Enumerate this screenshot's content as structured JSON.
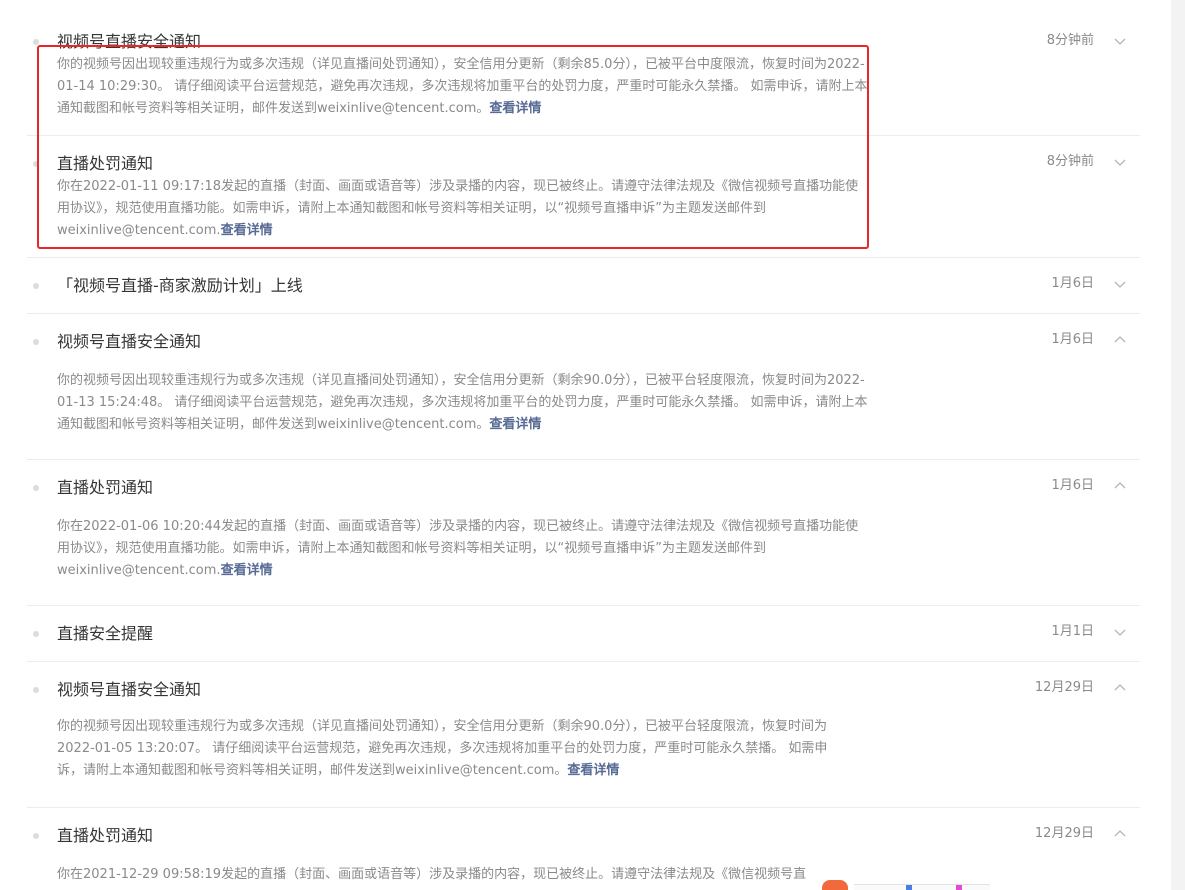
{
  "see_detail_label": "查看详情",
  "notices": [
    {
      "title": "视频号直播安全通知",
      "date": "8分钟前",
      "expanded": true,
      "body": "你的视频号因出现较重违规行为或多次违规（详见直播间处罚通知），安全信用分更新（剩余85.0分），已被平台中度限流，恢复时间为2022-01-14 10:29:30。 请仔细阅读平台运营规范，避免再次违规，多次违规将加重平台的处罚力度，严重时可能永久禁播。 如需申诉，请附上本通知截图和帐号资料等相关证明，邮件发送到weixinlive@tencent.com。"
    },
    {
      "title": "直播处罚通知",
      "date": "8分钟前",
      "expanded": true,
      "body": "你在2022-01-11 09:17:18发起的直播（封面、画面或语音等）涉及录播的内容，现已被终止。请遵守法律法规及《微信视频号直播功能使用协议》，规范使用直播功能。如需申诉，请附上本通知截图和帐号资料等相关证明，以“视频号直播申诉”为主题发送邮件到weixinlive@tencent.com."
    },
    {
      "title": "「视频号直播-商家激励计划」上线",
      "date": "1月6日",
      "expanded": false,
      "body": ""
    },
    {
      "title": "视频号直播安全通知",
      "date": "1月6日",
      "expanded": true,
      "body": "你的视频号因出现较重违规行为或多次违规（详见直播间处罚通知），安全信用分更新（剩余90.0分），已被平台轻度限流，恢复时间为2022-01-13 15:24:48。 请仔细阅读平台运营规范，避免再次违规，多次违规将加重平台的处罚力度，严重时可能永久禁播。 如需申诉，请附上本通知截图和帐号资料等相关证明，邮件发送到weixinlive@tencent.com。"
    },
    {
      "title": "直播处罚通知",
      "date": "1月6日",
      "expanded": true,
      "body": "你在2022-01-06 10:20:44发起的直播（封面、画面或语音等）涉及录播的内容，现已被终止。请遵守法律法规及《微信视频号直播功能使用协议》，规范使用直播功能。如需申诉，请附上本通知截图和帐号资料等相关证明，以“视频号直播申诉”为主题发送邮件到weixinlive@tencent.com."
    },
    {
      "title": "直播安全提醒",
      "date": "1月1日",
      "expanded": false,
      "body": ""
    },
    {
      "title": "视频号直播安全通知",
      "date": "12月29日",
      "expanded": true,
      "body": "你的视频号因出现较重违规行为或多次违规（详见直播间处罚通知），安全信用分更新（剩余90.0分），已被平台轻度限流，恢复时间为2022-01-05 13:20:07。 请仔细阅读平台运营规范，避免再次违规，多次违规将加重平台的处罚力度，严重时可能永久禁播。 如需申诉，请附上本通知截图和帐号资料等相关证明，邮件发送到weixinlive@tencent.com。"
    },
    {
      "title": "直播处罚通知",
      "date": "12月29日",
      "expanded": true,
      "body": "你在2021-12-29 09:58:19发起的直播（封面、画面或语音等）涉及录播的内容，现已被终止。请遵守法律法规及《微信视频号直"
    }
  ]
}
